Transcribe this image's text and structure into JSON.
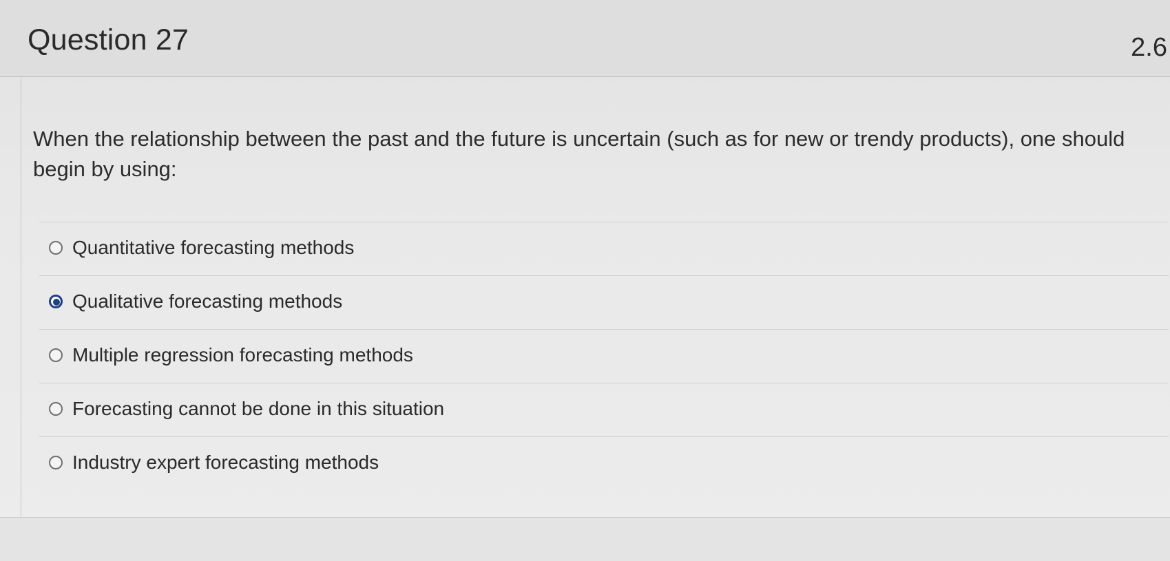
{
  "question": {
    "title": "Question 27",
    "points": "2.6",
    "text": "When the relationship between the past and the future is uncertain (such as for new or trendy products), one should begin by using:",
    "selected_index": 1,
    "answers": [
      {
        "label": "Quantitative forecasting methods",
        "selected": false
      },
      {
        "label": "Qualitative forecasting methods",
        "selected": true
      },
      {
        "label": "Multiple regression forecasting methods",
        "selected": false
      },
      {
        "label": "Forecasting cannot be done in this situation",
        "selected": false
      },
      {
        "label": "Industry expert forecasting methods",
        "selected": false
      }
    ]
  },
  "colors": {
    "selected_radio": "#1f3f86",
    "text": "#2b2b2b",
    "background": "#e7e7e7"
  }
}
